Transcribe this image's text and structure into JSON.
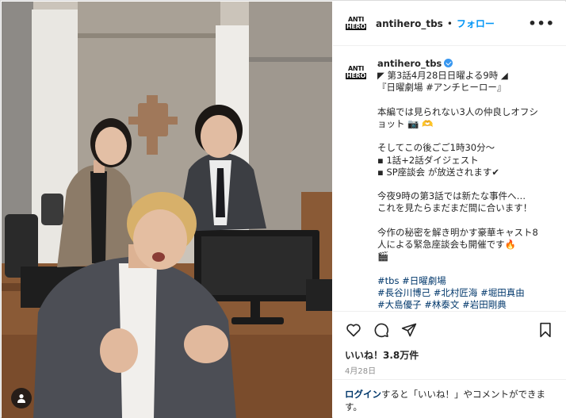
{
  "post": {
    "username": "antihero_tbs",
    "dot": "•",
    "follow_label": "フォロー",
    "more_label": "•••",
    "avatar_line1": "ANTI",
    "avatar_line2": "HERO"
  },
  "caption": {
    "username": "antihero_tbs",
    "lines": [
      "◤ 第3話4月28日日曜よる9時 ◢",
      "『日曜劇場 #アンチヒーロー』",
      "",
      "本編では見られない3人の仲良しオフショット 📷 🫶",
      "",
      "そしてこの後ごご1時30分〜",
      "▪ 1話+2話ダイジェスト",
      "▪ SP座談会 が放送されます✔",
      "",
      "今夜9時の第3話では新たな事件へ…",
      "これを見たらまだまだ間に合います！",
      "",
      "今作の秘密を解き明かす豪華キャスト8人による緊急座談会も開催です🔥",
      "🎬"
    ],
    "hashtags_line1": "#tbs #日曜劇場",
    "hashtags_line2": "#長谷川博己 #北村匠海 #堀田真由",
    "hashtags_line3": "#大島優子 #林泰文 #岩田剛典"
  },
  "actions": {
    "like": "heart-icon",
    "comment": "comment-icon",
    "share": "share-icon",
    "save": "bookmark-icon"
  },
  "likes_text": "いいね！3.8万件",
  "date_text": "4月28日",
  "login": {
    "link": "ログイン",
    "rest": "すると「いいね！」やコメントができます。"
  },
  "colors": {
    "accent": "#0095f6",
    "link": "#00376b",
    "border": "#dbdbdb"
  }
}
